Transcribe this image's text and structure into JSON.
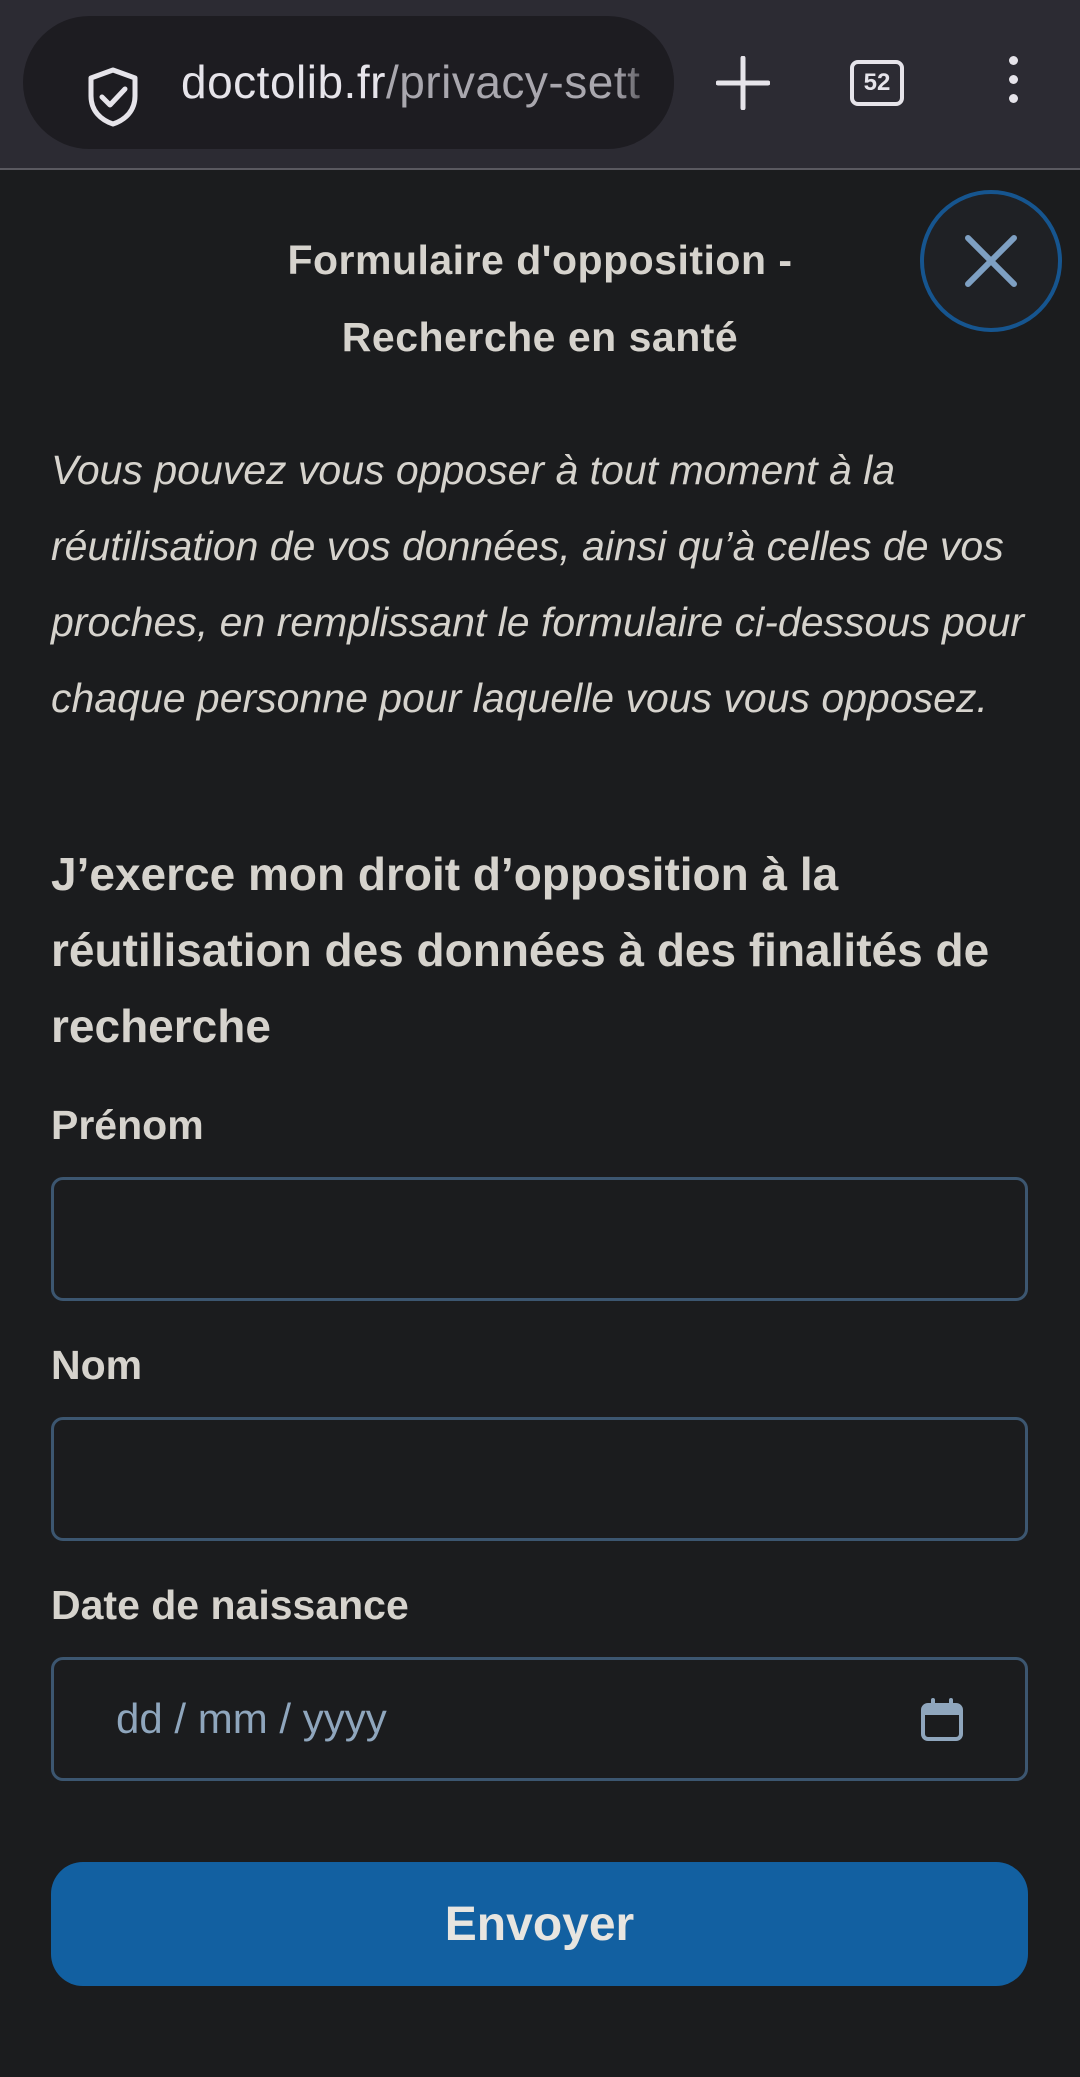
{
  "browser": {
    "url_domain": "doctolib.fr",
    "url_path": "/privacy-sett",
    "tab_count": "52",
    "icons": {
      "security": "shield-check-icon",
      "new_tab": "plus-icon",
      "tabs": "tabs-counter",
      "menu": "vertical-dots-icon"
    }
  },
  "dialog": {
    "title_line1": "Formulaire d'opposition -",
    "title_line2": "Recherche en santé",
    "close_icon": "close-icon"
  },
  "intro": "Vous pouvez vous opposer à tout moment à la réutilisation de vos données, ainsi qu’à celles de vos proches, en remplissant le formulaire ci-dessous pour chaque personne pour laquelle vous vous opposez.",
  "form": {
    "heading": "J’exerce mon droit d’opposition à la réutilisation des données à des finalités de recherche",
    "first_name_label": "Prénom",
    "first_name_value": "",
    "last_name_label": "Nom",
    "last_name_value": "",
    "birthdate_label": "Date de naissance",
    "birthdate_placeholder": "dd / mm / yyyy",
    "submit_label": "Envoyer"
  },
  "colors": {
    "background": "#1b1c1e",
    "browser_bar": "#2c2b33",
    "text": "#d6d3cd",
    "field_border": "#3c5670",
    "accent": "#1260a1",
    "placeholder": "#8fa6bd"
  }
}
